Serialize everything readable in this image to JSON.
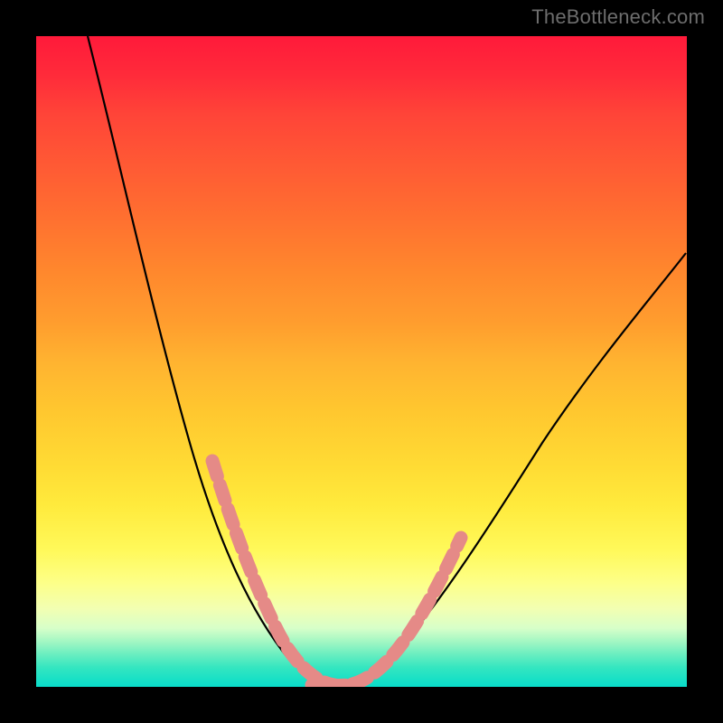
{
  "watermark": "TheBottleneck.com",
  "colors": {
    "background": "#000000",
    "curve": "#000000",
    "overlay_segment": "#e58a87"
  },
  "chart_data": {
    "type": "line",
    "title": "",
    "xlabel": "",
    "ylabel": "",
    "xlim": [
      0,
      100
    ],
    "ylim": [
      0,
      100
    ],
    "annotations": [
      "TheBottleneck.com"
    ],
    "series": [
      {
        "name": "bottleneck-curve",
        "x": [
          8,
          10,
          12,
          14,
          16,
          18,
          20,
          22,
          24,
          26,
          28,
          30,
          32,
          34,
          36,
          38,
          40,
          42,
          44,
          46,
          48,
          50,
          55,
          60,
          65,
          70,
          75,
          80,
          85,
          90,
          95,
          100
        ],
        "y": [
          100,
          93,
          86,
          79,
          72,
          65,
          58,
          51,
          45,
          39,
          33,
          27,
          22,
          17,
          12,
          8,
          5,
          2,
          0.5,
          0,
          0.5,
          2,
          7,
          14,
          22,
          30,
          37,
          44,
          51,
          57,
          62,
          67
        ]
      },
      {
        "name": "highlight-left-dashed",
        "x": [
          26,
          27.5,
          29,
          30.5,
          32,
          33.5,
          35,
          37,
          39,
          41,
          43,
          45
        ],
        "y": [
          37,
          33,
          30,
          26,
          22,
          18,
          15,
          10,
          6,
          3,
          1,
          0
        ]
      },
      {
        "name": "highlight-right-dashed",
        "x": [
          47,
          49,
          50.5,
          52,
          53.5,
          55,
          56.5,
          58,
          59.5,
          61,
          62.5
        ],
        "y": [
          0,
          1,
          3,
          5,
          8,
          11,
          14,
          17,
          20,
          23,
          25
        ]
      }
    ]
  }
}
